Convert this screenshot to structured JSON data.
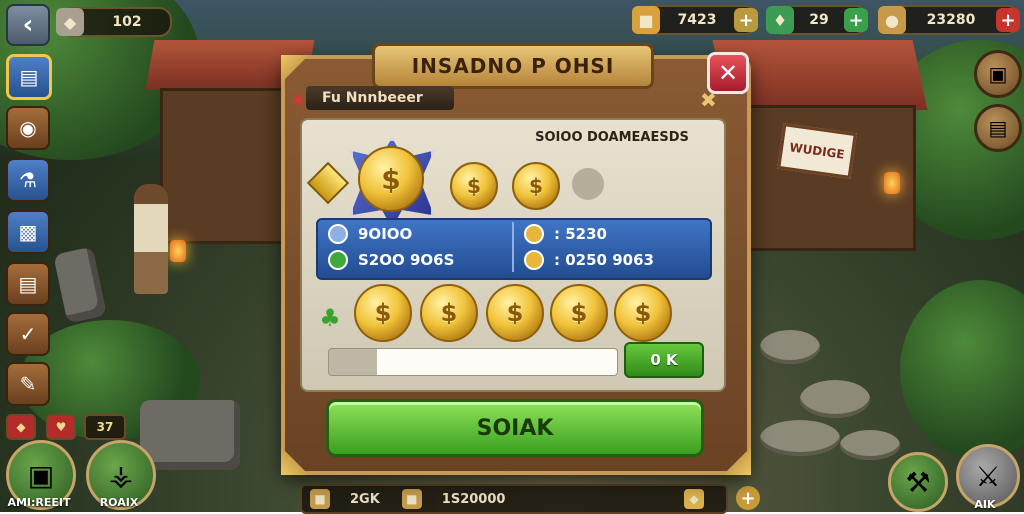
{
  "top_bar": {
    "back_icon": "chevron-left-icon",
    "resource_left": {
      "value": "102",
      "icon": "stone-icon"
    },
    "gold": {
      "value": "7423",
      "icon": "gold-crate-icon"
    },
    "gems": {
      "value": "29",
      "icon": "gem-icon"
    },
    "coins": {
      "value": "23280",
      "icon": "coin-bag-icon"
    }
  },
  "left_sidebar": {
    "items": [
      {
        "icon": "map-icon",
        "selected": true
      },
      {
        "icon": "horn-icon"
      },
      {
        "icon": "potion-icon"
      },
      {
        "icon": "book-icon"
      },
      {
        "icon": "scroll-icon"
      },
      {
        "icon": "checklist-icon"
      },
      {
        "icon": "note-icon"
      }
    ],
    "mini_counter": "37"
  },
  "bottom_left": {
    "button1_label": "AMI:REEIT",
    "button2_label": "ROAIX"
  },
  "bottom_right": {
    "button_label": "AIK"
  },
  "bottom_bar": {
    "item1": "2GK",
    "item2": "1S20000"
  },
  "shop_sign": "WUDIGE",
  "dialog": {
    "title": "INSADNO P OHSI",
    "subtitle": "Fu Nnnbeeer",
    "panel_heading": "SOIOO DOAMEAESDS",
    "coin_symbol": "$",
    "stats": {
      "left_top": "9OIOO",
      "left_bottom": "S2OO 9O6S",
      "right_top": ": 5230",
      "right_bottom": ": 0250 9063"
    },
    "ok_label": "0 K",
    "main_button": "SOIAK",
    "colors": {
      "accent_green": "#3a9f1f",
      "panel_blue": "#2f5fab",
      "close_red": "#c62b35"
    }
  }
}
